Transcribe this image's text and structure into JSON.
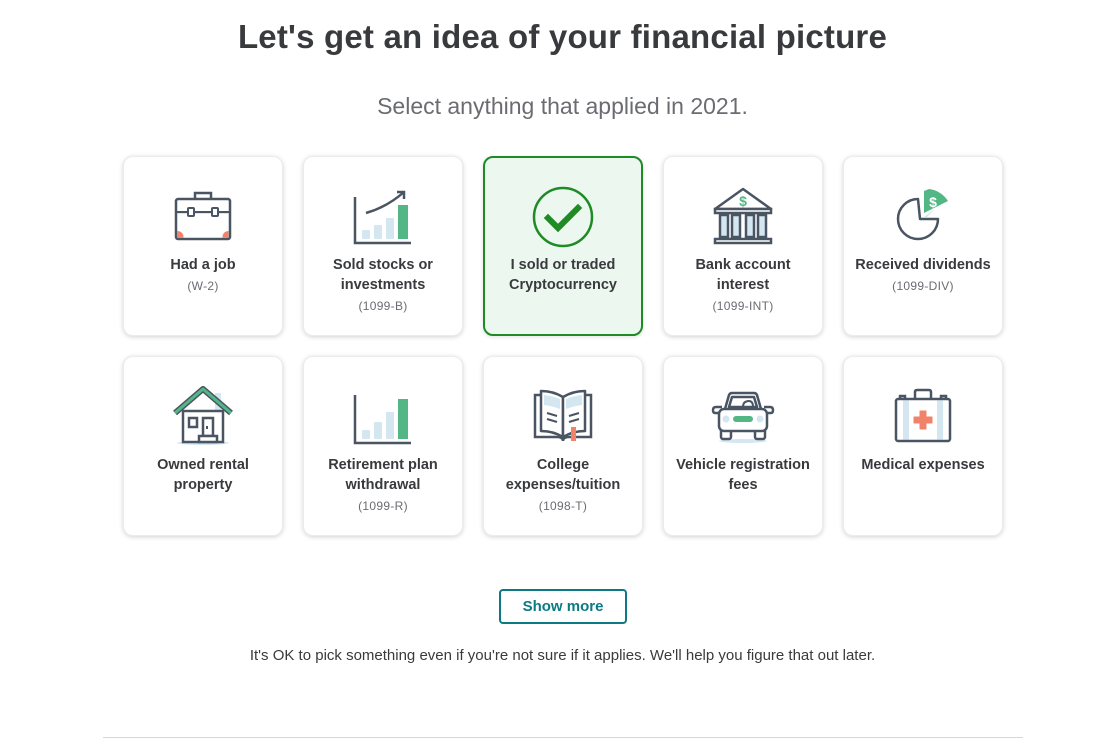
{
  "header": {
    "title": "Let's get an idea of your financial picture",
    "subtitle": "Select anything that applied in 2021."
  },
  "colors": {
    "accent_teal": "#0d7a83",
    "selected_green": "#1f8b24",
    "icon_green": "#53b785",
    "icon_light_blue": "#d4e7f1",
    "icon_coral": "#f2836b",
    "icon_stroke": "#4a5563"
  },
  "cards": [
    {
      "label": "Had a job",
      "form": "(W-2)",
      "icon": "briefcase-icon",
      "selected": false
    },
    {
      "label": "Sold stocks or investments",
      "form": "(1099-B)",
      "icon": "stock-growth-chart-icon",
      "selected": false
    },
    {
      "label": "I sold or traded Cryptocurrency",
      "form": "",
      "icon": "check-circle-icon",
      "selected": true
    },
    {
      "label": "Bank account interest",
      "form": "(1099-INT)",
      "icon": "bank-icon",
      "selected": false
    },
    {
      "label": "Received dividends",
      "form": "(1099-DIV)",
      "icon": "pie-dollar-icon",
      "selected": false
    },
    {
      "label": "Owned rental property",
      "form": "",
      "icon": "house-icon",
      "selected": false
    },
    {
      "label": "Retirement plan withdrawal",
      "form": "(1099-R)",
      "icon": "bar-chart-icon",
      "selected": false
    },
    {
      "label": "College expenses/tuition",
      "form": "(1098-T)",
      "icon": "open-book-icon",
      "selected": false
    },
    {
      "label": "Vehicle registration fees",
      "form": "",
      "icon": "car-icon",
      "selected": false
    },
    {
      "label": "Medical expenses",
      "form": "",
      "icon": "medical-kit-icon",
      "selected": false
    }
  ],
  "show_more_label": "Show more",
  "note": "It's OK to pick something even if you're not sure if it applies. We'll help you figure that out later."
}
